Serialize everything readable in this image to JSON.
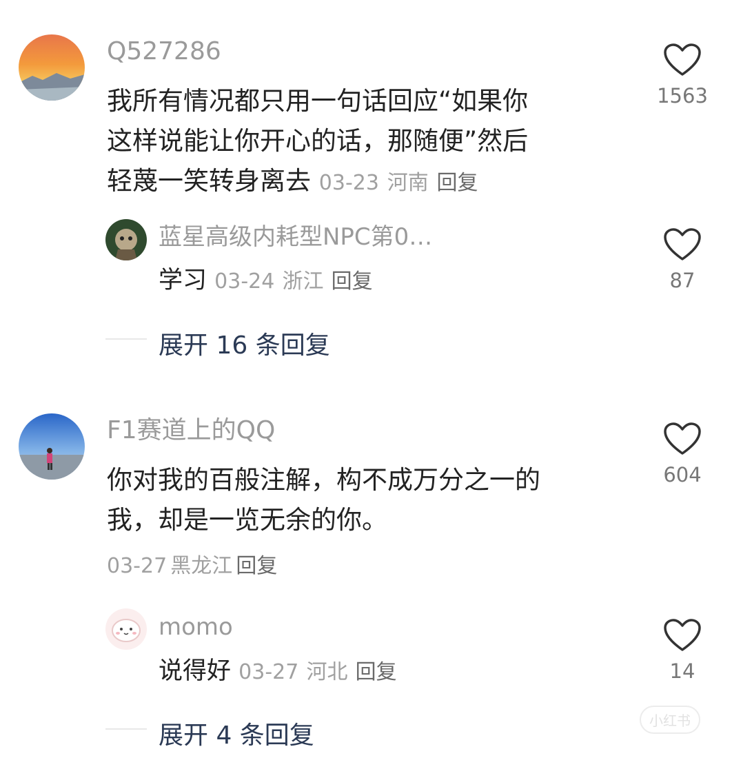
{
  "comments": [
    {
      "username": "Q527286",
      "text": "我所有情况都只用一句话回应“如果你这样说能让你开心的话，那随便”然后轻蔑一笑转身离去",
      "lines": [
        "我所有情况都只用一句话回应“如果你",
        "这样说能让你开心的话，那随便”然后",
        "轻蔑一笑转身离去"
      ],
      "date": "03-23",
      "location": "河南",
      "reply_label": "回复",
      "likes": "1563",
      "sub_reply": {
        "username": "蓝星高级内耗型NPC第0…",
        "text": "学习",
        "date": "03-24",
        "location": "浙江",
        "reply_label": "回复",
        "likes": "87"
      },
      "expand_label": "展开 16 条回复"
    },
    {
      "username": "F1赛道上的QQ",
      "lines": [
        "你对我的百般注解，构不成万分之一的",
        "我，却是一览无余的你。"
      ],
      "date": "03-27",
      "location": "黑龙江",
      "reply_label": "回复",
      "likes": "604",
      "sub_reply": {
        "username": "momo",
        "text": "说得好",
        "date": "03-27",
        "location": "河北",
        "reply_label": "回复",
        "likes": "14"
      },
      "expand_label": "展开 4 条回复"
    }
  ],
  "watermark": "小红书",
  "icons": {
    "like": "heart-outline-icon"
  },
  "colors": {
    "username": "#9a9a9a",
    "text": "#222222",
    "meta": "#a0a0a0",
    "expand": "#2b3a55"
  }
}
